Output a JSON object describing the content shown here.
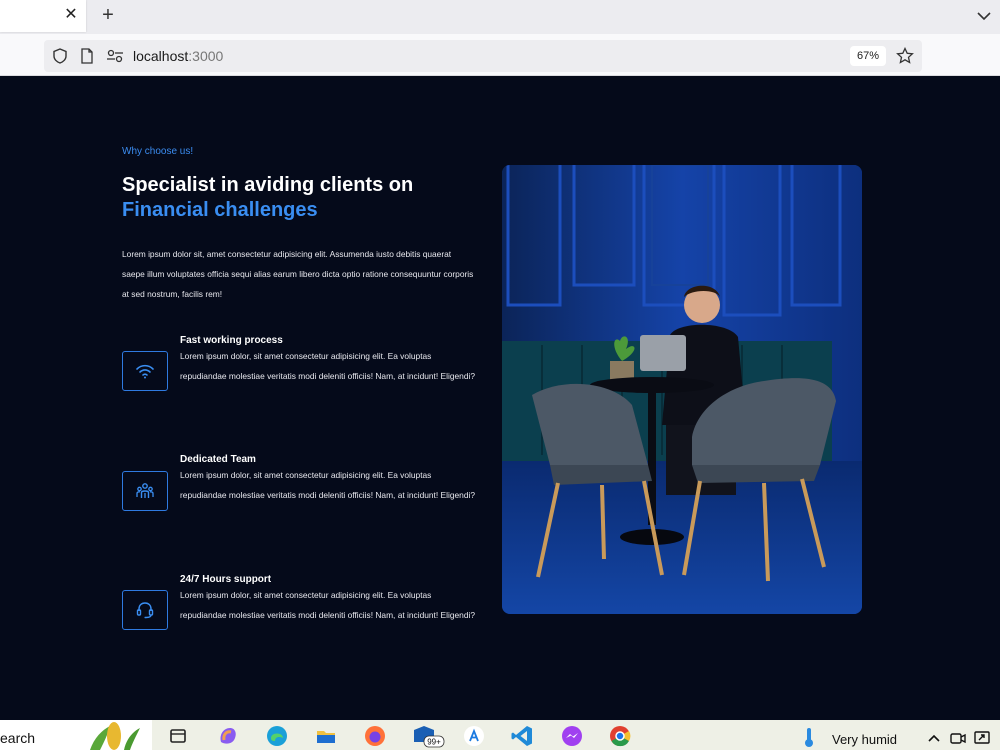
{
  "browser": {
    "tab_close": "✕",
    "new_tab": "+",
    "url_host": "localhost",
    "url_port": ":3000",
    "zoom": "67%"
  },
  "hero": {
    "eyebrow": "Why choose us!",
    "title_line1": "Specialist in aviding clients on",
    "title_line2": "Financial challenges",
    "intro": "Lorem ipsum dolor sit, amet consectetur adipisicing elit. Assumenda iusto debitis quaerat saepe illum voluptates officia sequi alias earum libero dicta optio ratione consequuntur corporis at sed nostrum, facilis rem!"
  },
  "features": [
    {
      "icon": "wifi-icon",
      "title": "Fast working process",
      "description": "Lorem ipsum dolor, sit amet consectetur adipisicing elit. Ea voluptas repudiandae molestiae veritatis modi deleniti officiis! Nam, at incidunt! Eligendi?"
    },
    {
      "icon": "team-icon",
      "title": "Dedicated Team",
      "description": "Lorem ipsum dolor, sit amet consectetur adipisicing elit. Ea voluptas repudiandae molestiae veritatis modi deleniti officiis! Nam, at incidunt! Eligendi?"
    },
    {
      "icon": "headset-icon",
      "title": "24/7 Hours support",
      "description": "Lorem ipsum dolor, sit amet consectetur adipisicing elit. Ea voluptas repudiandae molestiae veritatis modi deleniti officiis! Nam, at incidunt! Eligendi?"
    }
  ],
  "taskbar": {
    "search_text": "earch",
    "mail_badge": "99+",
    "weather": "Very humid"
  },
  "colors": {
    "page_bg": "#050a1a",
    "accent": "#3a8ef2"
  }
}
